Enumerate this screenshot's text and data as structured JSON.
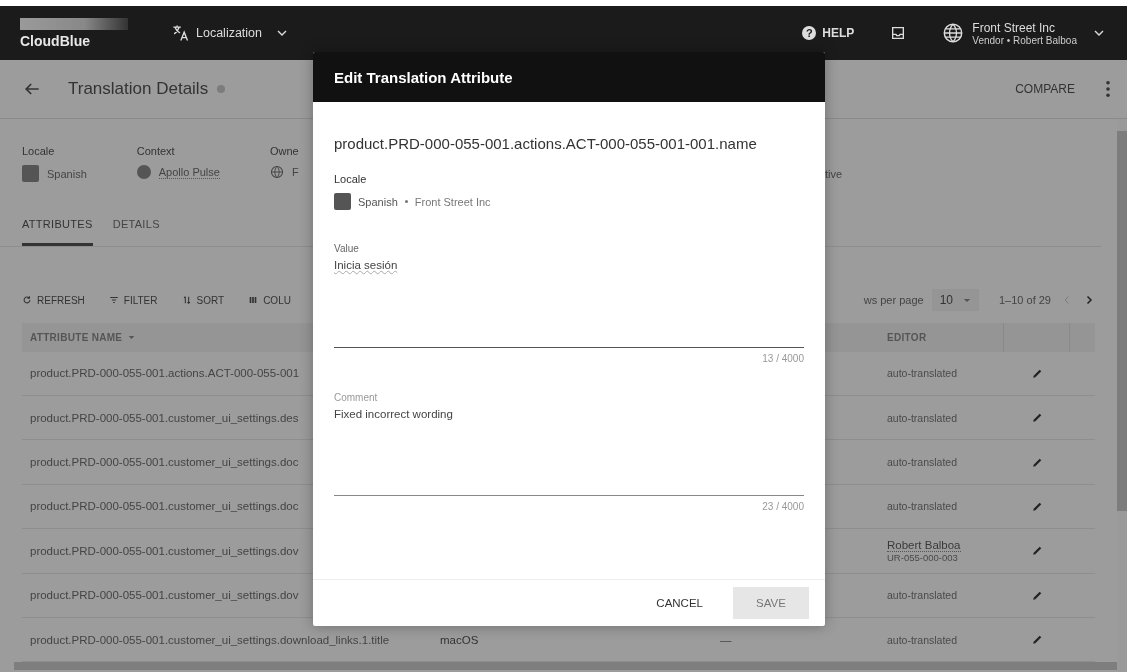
{
  "topbar": {
    "logo": "CloudBlue",
    "module": "Localization",
    "help_icon": "?",
    "help": "HELP",
    "account": {
      "name": "Front Street Inc",
      "subtitle": "Vendor • Robert Balboa"
    }
  },
  "page": {
    "title": "Translation Details",
    "compare": "COMPARE"
  },
  "info": [
    {
      "label": "Locale",
      "value": "Spanish",
      "kind": "flag"
    },
    {
      "label": "Context",
      "value": "Apollo Pulse",
      "kind": "logo"
    },
    {
      "label": "Owne",
      "value": "F",
      "kind": "globe"
    }
  ],
  "status_fragment": "tive",
  "tabs": [
    {
      "label": "ATTRIBUTES",
      "selected": true
    },
    {
      "label": "DETAILS",
      "selected": false
    }
  ],
  "toolbar": [
    {
      "label": "REFRESH",
      "kind": "refresh"
    },
    {
      "label": "FILTER",
      "kind": "filter"
    },
    {
      "label": "SORT",
      "kind": "sort"
    },
    {
      "label": "COLU",
      "kind": "columns"
    }
  ],
  "pagination": {
    "rows_per_page_label": "ws per page",
    "rows_per_page": "10",
    "range": "1–10 of 29"
  },
  "table": {
    "columns": [
      {
        "label": "ATTRIBUTE NAME",
        "sorted": true
      },
      {
        "label": "EDITOR",
        "sorted": false
      },
      {
        "sorted": false
      }
    ],
    "rows": [
      {
        "name": "product.PRD-000-055-001.actions.ACT-000-055-001",
        "editor": "auto-translated"
      },
      {
        "name": "product.PRD-000-055-001.customer_ui_settings.des",
        "editor": "auto-translated"
      },
      {
        "name": "product.PRD-000-055-001.customer_ui_settings.doc",
        "editor": "auto-translated"
      },
      {
        "name": "product.PRD-000-055-001.customer_ui_settings.doc",
        "editor": "auto-translated"
      },
      {
        "name": "product.PRD-000-055-001.customer_ui_settings.dov",
        "editor": "Robert Balboa",
        "editor_id": "UR-055-000-003"
      },
      {
        "name": "product.PRD-000-055-001.customer_ui_settings.dov",
        "editor": "auto-translated"
      },
      {
        "name": "product.PRD-000-055-001.customer_ui_settings.download_links.1.title",
        "value": "macOS",
        "column_3": "—",
        "editor": "auto-translated"
      }
    ]
  },
  "dialog": {
    "title": "Edit Translation Attribute",
    "attribute": "product.PRD-000-055-001.actions.ACT-000-055-001-001.name",
    "locale_label": "Locale",
    "locale": "Spanish",
    "owner": "Front Street Inc",
    "value_field": {
      "label": "Value",
      "value": "Inicia sesión",
      "counter": "13 / 4000"
    },
    "comment_field": {
      "label": "Comment",
      "value": "Fixed incorrect wording",
      "counter": "23 / 4000"
    },
    "buttons": [
      {
        "label": "CANCEL",
        "kind": "text"
      },
      {
        "label": "SAVE",
        "kind": "filled"
      }
    ]
  }
}
